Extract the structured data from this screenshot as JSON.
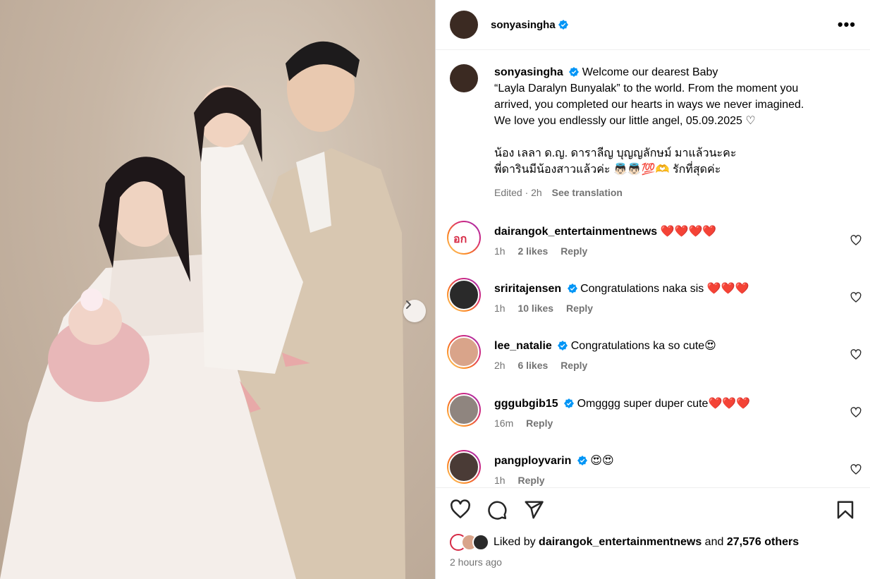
{
  "post": {
    "username": "sonyasingha",
    "more_label": "•••",
    "next_label": "›"
  },
  "caption": {
    "username": "sonyasingha",
    "line1": "Welcome our dearest Baby",
    "line2": "“Layla Daralyn Bunyalak” to the world. From the moment you",
    "line3": "arrived, you completed our hearts in ways we never imagined.",
    "line4": "We love you endlessly our little angel, 05.09.2025 ♡",
    "thai1": "น้อง เลลา ด.ญ. ดาราลีญ บุญญลักษม์ มาแล้วนะคะ",
    "thai2": "พี่ดารินมีน้องสาวแล้วค่ะ 👼🏻👼🏻💯🫶 รักที่สุดค่ะ",
    "edited": "Edited · 2h",
    "see_translation": "See translation"
  },
  "comments": [
    {
      "username": "dairangok_entertainmentnews",
      "verified": false,
      "text": "❤️❤️❤️❤️",
      "time": "1h",
      "likes": "2 likes",
      "reply": "Reply"
    },
    {
      "username": "sriritajensen",
      "verified": true,
      "text": "Congratulations naka sis ❤️❤️❤️",
      "time": "1h",
      "likes": "10 likes",
      "reply": "Reply"
    },
    {
      "username": "lee_natalie",
      "verified": true,
      "text": "Congratulations ka so cute😍",
      "time": "2h",
      "likes": "6 likes",
      "reply": "Reply"
    },
    {
      "username": "gggubgib15",
      "verified": true,
      "text": "Omgggg super duper cute❤️❤️❤️",
      "time": "16m",
      "likes": "",
      "reply": "Reply"
    },
    {
      "username": "pangployvarin",
      "verified": true,
      "text": "😍😍",
      "time": "1h",
      "likes": "",
      "reply": "Reply"
    }
  ],
  "likes": {
    "prefix": "Liked by",
    "user": "dairangok_entertainmentnews",
    "and": "and",
    "count": "27,576 others"
  },
  "posted": "2 hours ago",
  "colors": {
    "verified_blue": "#0095f6",
    "muted": "#737373"
  }
}
